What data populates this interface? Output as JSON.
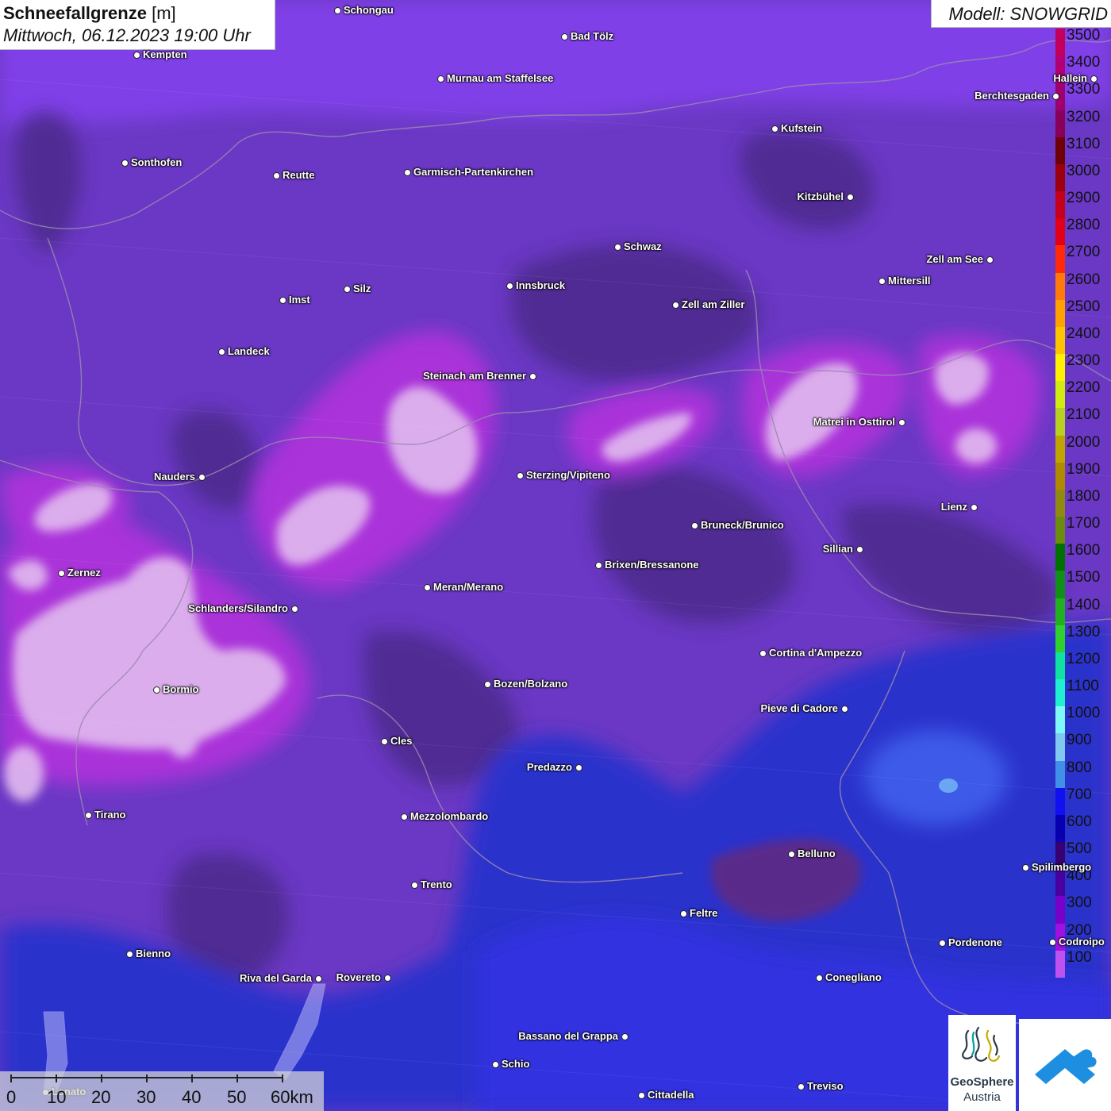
{
  "title": {
    "bold": "Schneefallgrenze",
    "unit": "[m]",
    "datetime": "Mittwoch, 06.12.2023 19:00 Uhr"
  },
  "model": "Modell: SNOWGRID",
  "legend": {
    "labels": [
      "3500",
      "3400",
      "3300",
      "3200",
      "3100",
      "3000",
      "2900",
      "2800",
      "2700",
      "2600",
      "2500",
      "2400",
      "2300",
      "2200",
      "2100",
      "2000",
      "1900",
      "1800",
      "1700",
      "1600",
      "1500",
      "1400",
      "1300",
      "1200",
      "1100",
      "1000",
      "900",
      "800",
      "700",
      "600",
      "500",
      "400",
      "300",
      "200",
      "100"
    ],
    "colors": [
      "#c2005c",
      "#b00072",
      "#9e0070",
      "#88005a",
      "#6e0008",
      "#9c0010",
      "#c4001c",
      "#e20018",
      "#ff2a0a",
      "#ff7a0a",
      "#ffa200",
      "#ffc400",
      "#fff200",
      "#d0ec10",
      "#b8d020",
      "#c0a400",
      "#b08a00",
      "#908a10",
      "#6c8c10",
      "#007000",
      "#109018",
      "#20b020",
      "#30d030",
      "#10e0a0",
      "#20f0d0",
      "#80f8f8",
      "#80c8f0",
      "#4090e8",
      "#1010f0",
      "#0800b0",
      "#380070",
      "#4a00a0",
      "#7800c8",
      "#a010e0",
      "#c050f0"
    ]
  },
  "cities": [
    {
      "name": "Schongau"
    },
    {
      "name": "Kempten"
    },
    {
      "name": "Bad Tölz"
    },
    {
      "name": "Murnau am Staffelsee"
    },
    {
      "name": "Hallein"
    },
    {
      "name": "Berchtesgaden"
    },
    {
      "name": "Kufstein"
    },
    {
      "name": "Sonthofen"
    },
    {
      "name": "Reutte"
    },
    {
      "name": "Garmisch-Partenkirchen"
    },
    {
      "name": "Kitzbühel"
    },
    {
      "name": "Schwaz"
    },
    {
      "name": "Zell am See"
    },
    {
      "name": "Mittersill"
    },
    {
      "name": "Innsbruck"
    },
    {
      "name": "Silz"
    },
    {
      "name": "Imst"
    },
    {
      "name": "Zell am Ziller"
    },
    {
      "name": "Landeck"
    },
    {
      "name": "Steinach am Brenner"
    },
    {
      "name": "Matrei in Osttirol"
    },
    {
      "name": "Nauders"
    },
    {
      "name": "Sterzing/Vipiteno"
    },
    {
      "name": "Lienz"
    },
    {
      "name": "Bruneck/Brunico"
    },
    {
      "name": "Sillian"
    },
    {
      "name": "Zernez"
    },
    {
      "name": "Brixen/Bressanone"
    },
    {
      "name": "Meran/Merano"
    },
    {
      "name": "Schlanders/Silandro"
    },
    {
      "name": "Cortina d'Ampezzo"
    },
    {
      "name": "Bozen/Bolzano"
    },
    {
      "name": "Bormio"
    },
    {
      "name": "Pieve di Cadore"
    },
    {
      "name": "Cles"
    },
    {
      "name": "Predazzo"
    },
    {
      "name": "Tirano"
    },
    {
      "name": "Mezzolombardo"
    },
    {
      "name": "Belluno"
    },
    {
      "name": "Spilimbergo"
    },
    {
      "name": "Trento"
    },
    {
      "name": "Feltre"
    },
    {
      "name": "Pordenone"
    },
    {
      "name": "Codroipo"
    },
    {
      "name": "Bienno"
    },
    {
      "name": "Riva del Garda"
    },
    {
      "name": "Rovereto"
    },
    {
      "name": "Conegliano"
    },
    {
      "name": "Bassano del Grappa"
    },
    {
      "name": "Schio"
    },
    {
      "name": "Lonato"
    },
    {
      "name": "Treviso"
    },
    {
      "name": "Cittadella"
    }
  ],
  "scale": {
    "ticks": [
      "0",
      "10",
      "20",
      "30",
      "40",
      "50",
      "60km"
    ]
  },
  "logos": {
    "geosphere_line1": "GeoSphere",
    "geosphere_line2": "Austria"
  }
}
